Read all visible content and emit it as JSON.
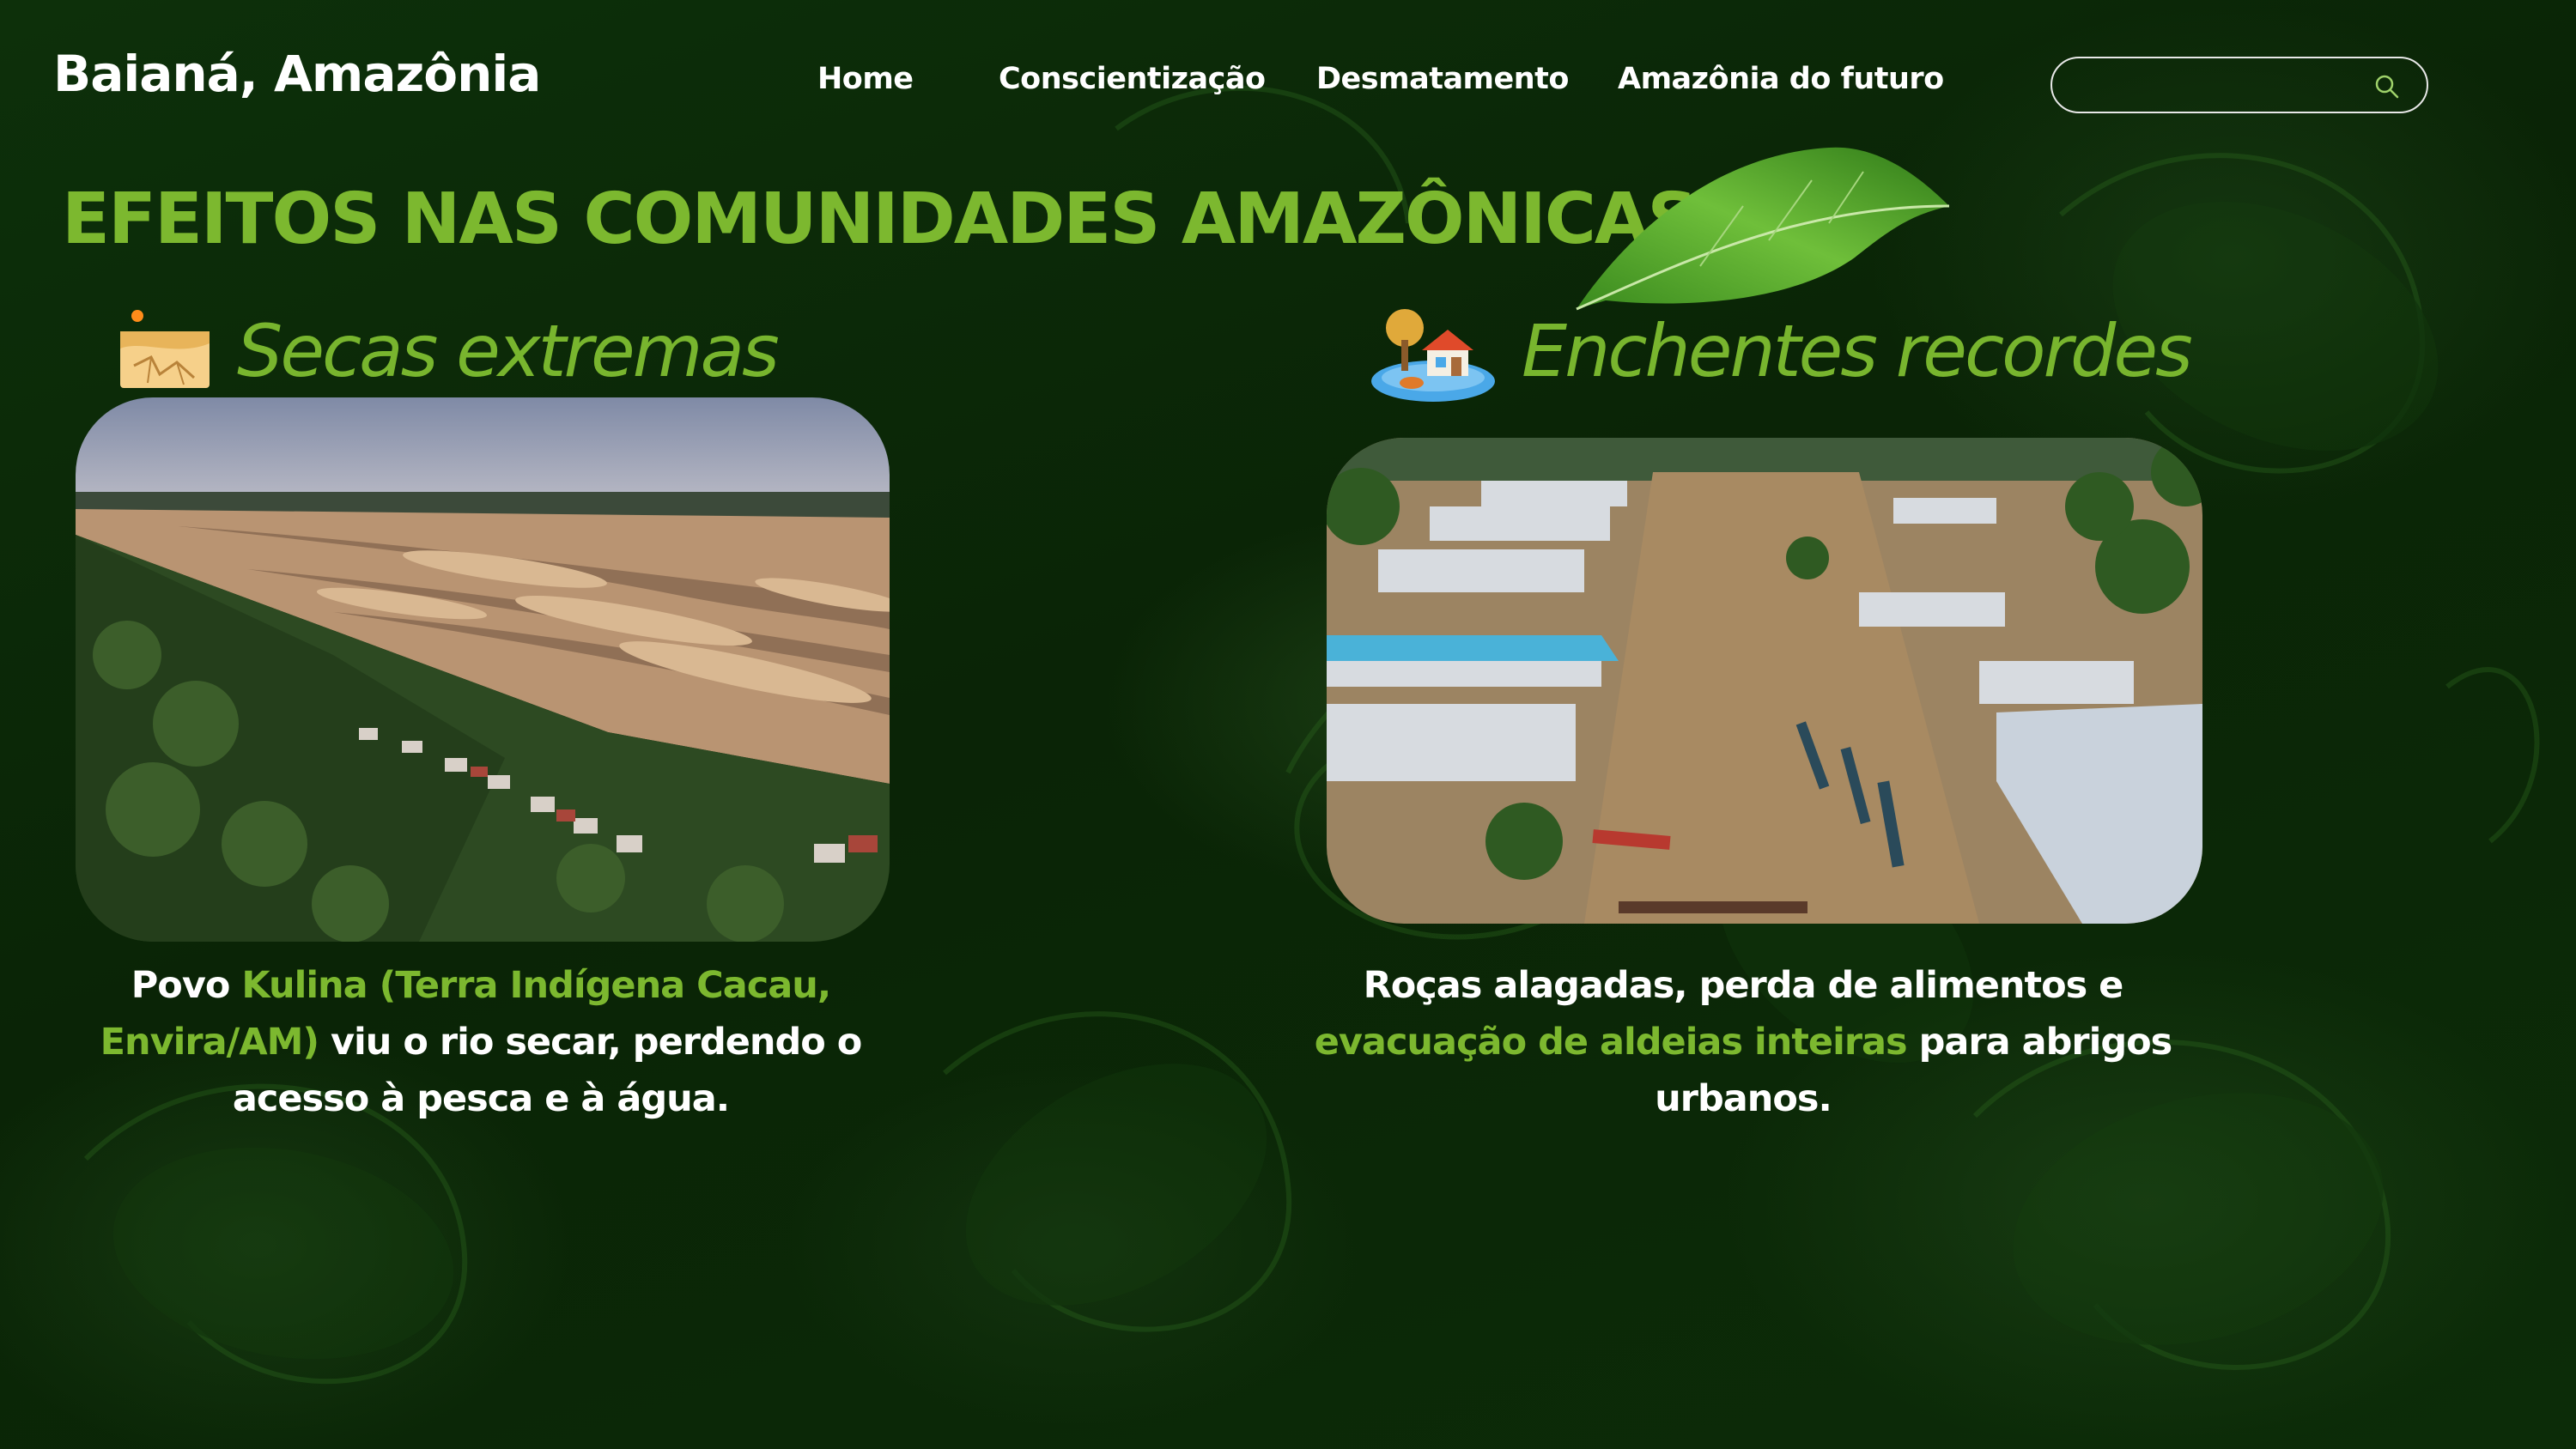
{
  "header": {
    "brand": "Baianá, Amazônia",
    "nav": [
      {
        "label": "Home"
      },
      {
        "label": "Conscientização"
      },
      {
        "label": "Desmatamento"
      },
      {
        "label": "Amazônia do futuro"
      }
    ],
    "search": {
      "value": "",
      "placeholder": "",
      "icon": "search-icon"
    }
  },
  "main": {
    "title": "EFEITOS NAS COMUNIDADES AMAZÔNICAS",
    "decoration_icon": "leaf-icon",
    "sections": [
      {
        "heading": "Secas extremas",
        "icon": "desert-icon",
        "image": "dry-riverbed-village-photo",
        "caption": {
          "part1": "Povo ",
          "highlight": "Kulina (Terra Indígena Cacau, Envira/AM)",
          "part2": " viu o rio secar, perdendo o acesso à pesca e à água."
        }
      },
      {
        "heading": "Enchentes recordes",
        "icon": "flooded-house-icon",
        "image": "flooded-town-photo",
        "caption": {
          "part1": "Roças alagadas, perda de alimentos e ",
          "highlight": "evacuação de aldeias inteiras",
          "part2": " para abrigos urbanos."
        }
      }
    ]
  },
  "colors": {
    "background": "#0b2a07",
    "accent_green": "#7cb82f",
    "text": "#ffffff"
  }
}
